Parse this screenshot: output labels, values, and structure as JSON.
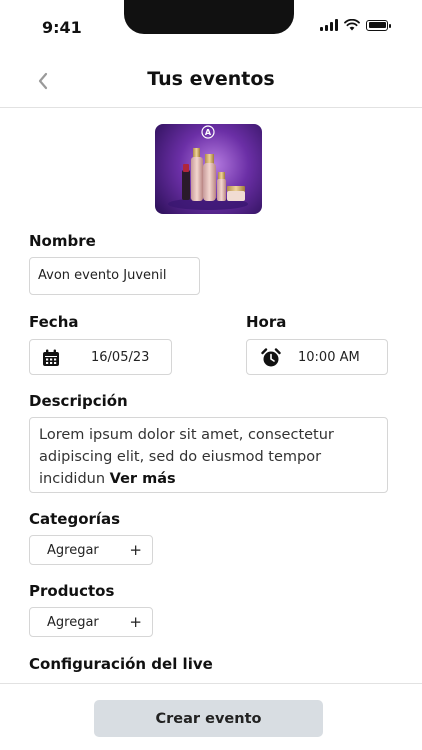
{
  "status_bar": {
    "time": "9:41"
  },
  "header": {
    "title": "Tus eventos"
  },
  "form": {
    "name": {
      "label": "Nombre",
      "value": "Avon evento Juvenil"
    },
    "date": {
      "label": "Fecha",
      "value": "16/05/23"
    },
    "time": {
      "label": "Hora",
      "value": "10:00 AM"
    },
    "description": {
      "label": "Descripción",
      "value": "Lorem ipsum dolor sit amet, consectetur adipiscing elit, sed do eiusmod tempor incididun",
      "see_more": "Ver más"
    },
    "categories": {
      "label": "Categorías",
      "add_label": "Agregar"
    },
    "products": {
      "label": "Productos",
      "add_label": "Agregar"
    },
    "live_config": {
      "label": "Configuración del live"
    }
  },
  "footer": {
    "submit_label": "Crear evento"
  },
  "event_image": {
    "brand_logo_text": "A"
  },
  "icons": {
    "back": "chevron-left-icon",
    "calendar": "calendar-icon",
    "clock": "alarm-clock-icon",
    "plus": "plus-icon"
  },
  "colors": {
    "primary_button": "#d8dde2",
    "border": "#d6d6d6"
  }
}
